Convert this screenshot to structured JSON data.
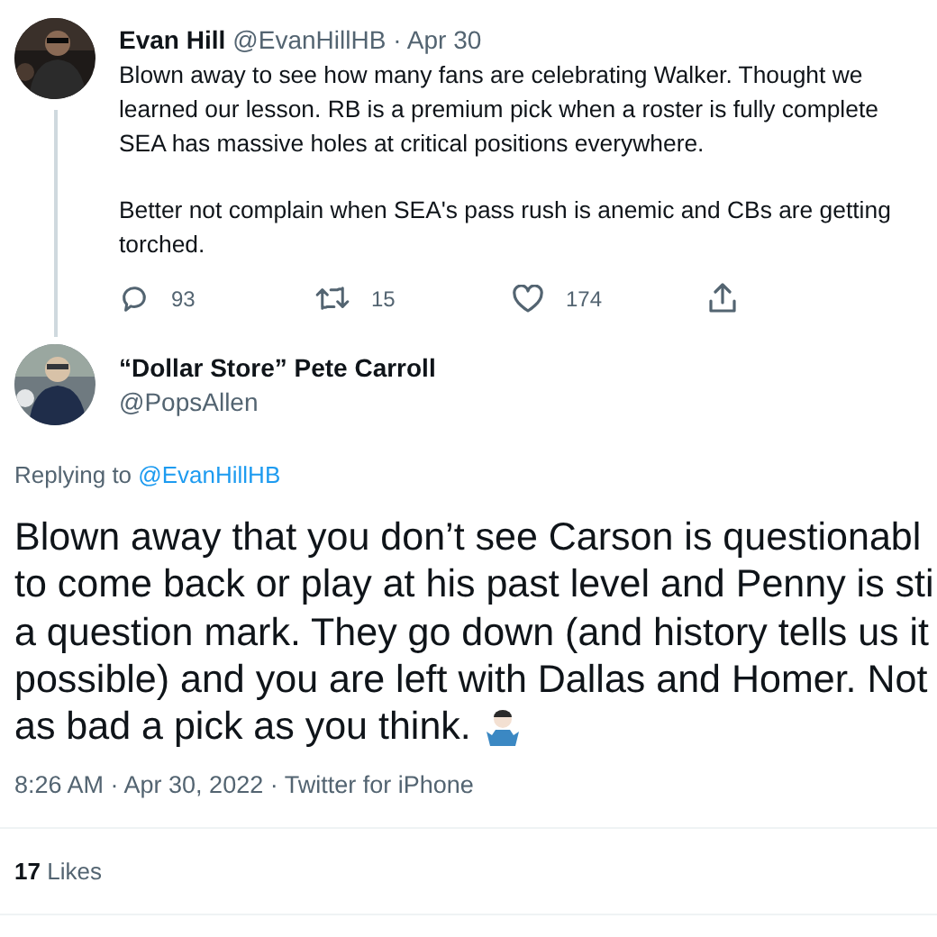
{
  "tweet": {
    "name": "Evan Hill",
    "handle": "@EvanHillHB",
    "time": "· Apr 30",
    "paragraphs": [
      [
        "Blown away to see how many fans are celebrating Walker. Thought we",
        "learned our lesson. RB is a premium pick when a roster is fully complete",
        "SEA has massive holes at critical positions everywhere."
      ],
      [
        "Better not complain when SEA's pass rush is anemic and CBs are getting",
        "torched."
      ]
    ],
    "actions": [
      {
        "kind": "reply",
        "count": "93"
      },
      {
        "kind": "retweet",
        "count": "15"
      },
      {
        "kind": "like",
        "count": "174"
      },
      {
        "kind": "share"
      }
    ]
  },
  "reply": {
    "name": "“Dollar Store” Pete Carroll",
    "handle": "@PopsAllen",
    "replying_prefix": "Replying to",
    "replying_to": "@EvanHillHB",
    "body_lines": [
      "Blown away that you don’t see Carson is questionabl",
      "to come back or play at his past level and Penny is sti",
      "a question mark. They go down (and history tells us it",
      "possible) and you are left with Dallas and Homer. Not",
      "as bad a pick as you think."
    ],
    "meta": "8:26 AM · Apr 30, 2022 · Twitter for iPhone",
    "likes_count": "17",
    "likes_label": "Likes"
  }
}
